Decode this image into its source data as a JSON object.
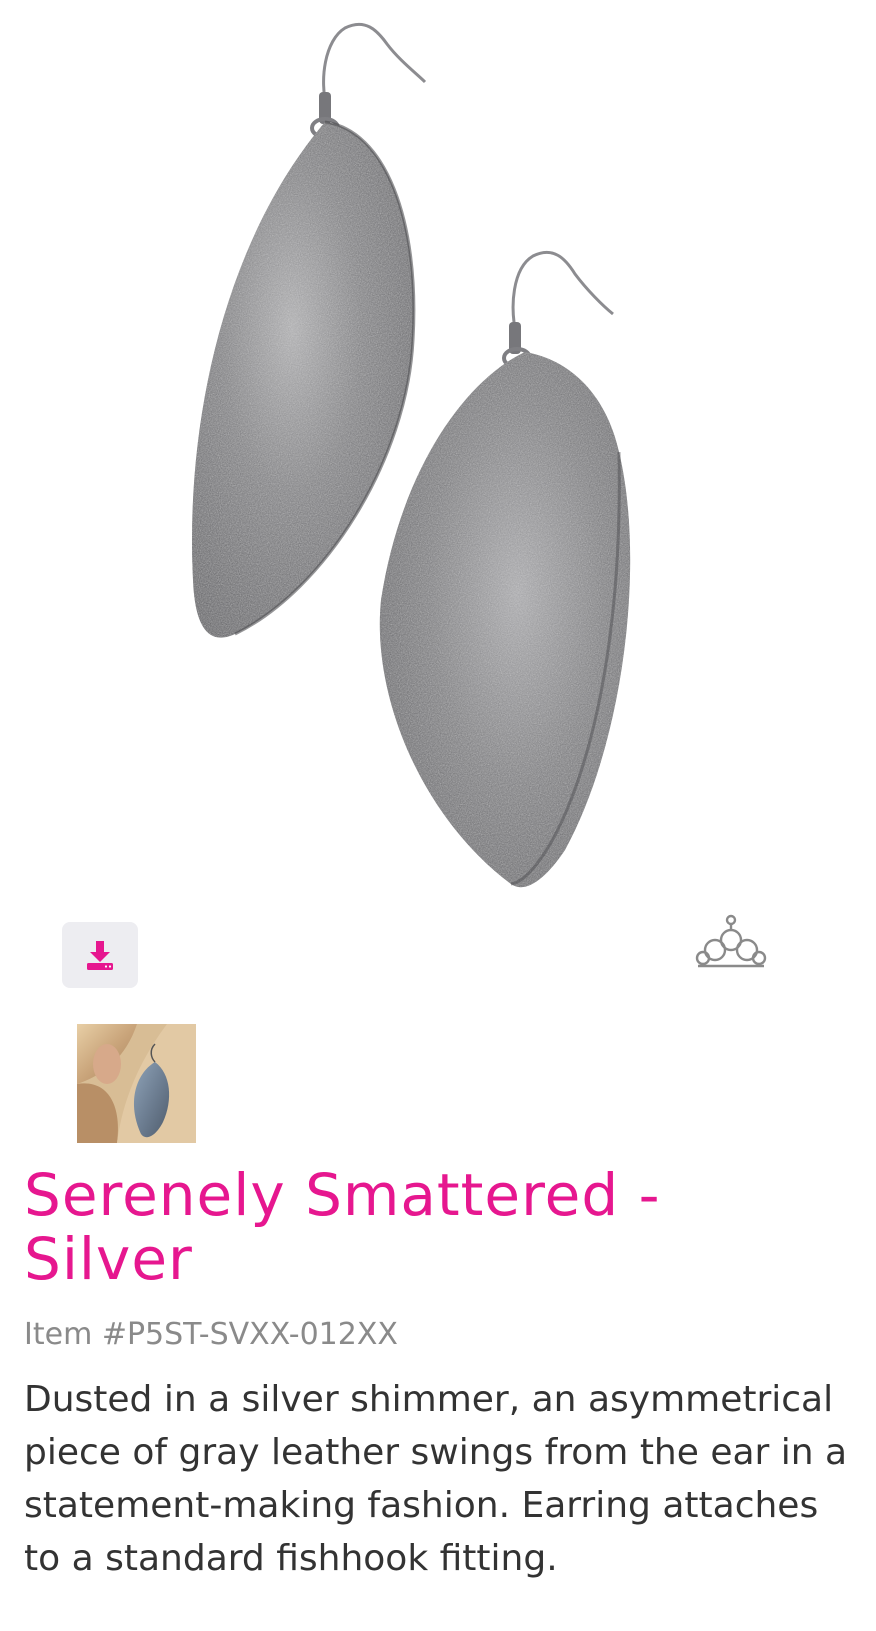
{
  "product": {
    "title": "Serenely Smattered - Silver",
    "item_number": "Item #P5ST-SVXX-012XX",
    "description": "Dusted in a silver shimmer, an asymmetrical piece of gray leather swings from the ear in a statement-making fashion. Earring attaches to a standard fishhook fitting."
  },
  "icons": {
    "download": "download-icon",
    "brand": "crown-logo-icon"
  },
  "colors": {
    "accent": "#e6178f",
    "item_number": "#8a8a8a",
    "body_text": "#333333",
    "button_bg": "#ededf1"
  }
}
